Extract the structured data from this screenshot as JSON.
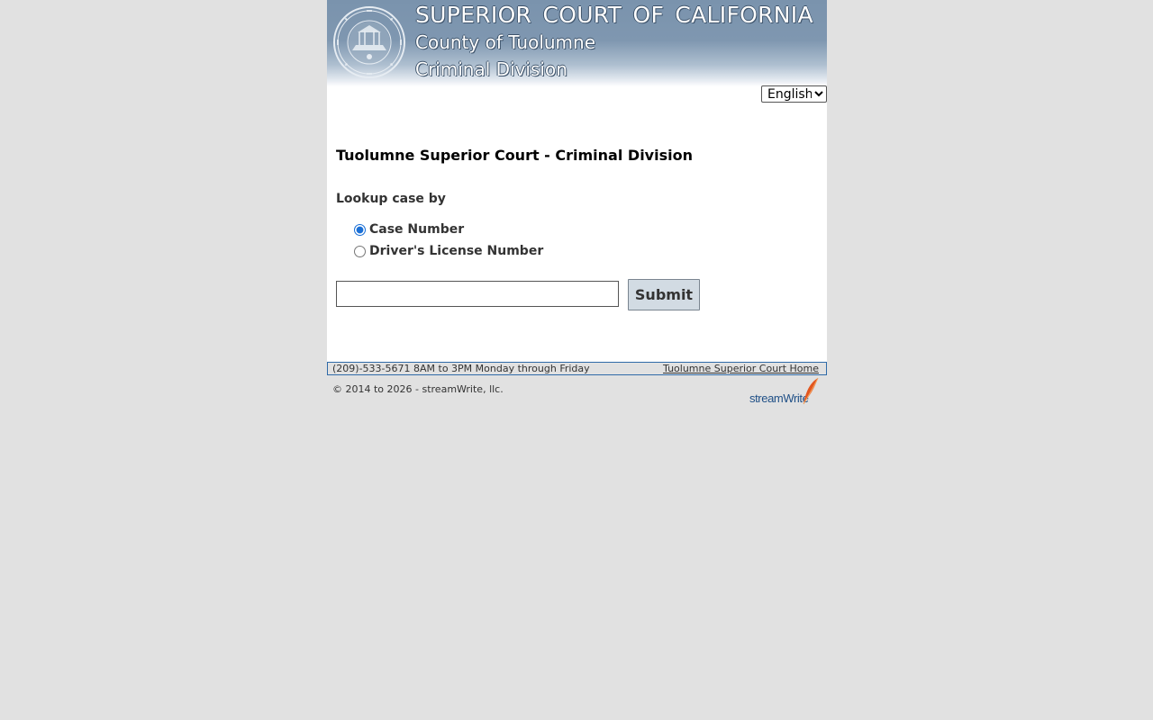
{
  "banner": {
    "line1": "SUPERIOR  COURT OF CALIFORNIA",
    "line2": "County of Tuolumne",
    "line3": "Criminal Division",
    "seal_icon": "court-seal-icon"
  },
  "language": {
    "selected": "English"
  },
  "main": {
    "title": "Tuolumne Superior Court - Criminal Division",
    "lookup_label": "Lookup case by",
    "options": [
      {
        "label": "Case Number",
        "checked": true
      },
      {
        "label": "Driver's License Number",
        "checked": false
      }
    ],
    "search_value": "",
    "submit_label": "Submit"
  },
  "footer": {
    "phone_hours": "(209)-533-5671 8AM to 3PM Monday through Friday",
    "home_link": "Tuolumne Superior Court Home",
    "copyright": "© 2014 to 2026 - streamWrite, llc.",
    "logo_text": "streamWrite",
    "logo_icon": "feather-quill-icon"
  },
  "colors": {
    "page_background": "#e1e1e1",
    "banner_blue": "#7a93ad",
    "footer_border": "#2f6aa8",
    "button_background": "#d2dbe3",
    "logo_blue": "#1f4f86",
    "feather_orange": "#e2561f"
  }
}
